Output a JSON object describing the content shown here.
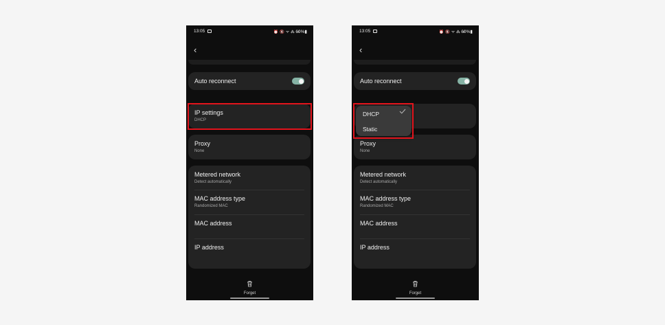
{
  "status": {
    "time": "13:05",
    "icons": "⏰ 🔇 ᯤ ⁂ .ıl",
    "battery": "60%▮"
  },
  "settings": {
    "auto_reconnect": "Auto reconnect",
    "ip_settings": "IP settings",
    "ip_value": "DHCP",
    "proxy": "Proxy",
    "proxy_value": "None",
    "metered": "Metered network",
    "metered_value": "Detect automatically",
    "mac_type": "MAC address type",
    "mac_type_value": "Randomized MAC",
    "mac_address": "MAC address",
    "ip_address": "IP address",
    "forget": "Forget"
  },
  "popup": {
    "selected": "DHCP",
    "other": "Static"
  },
  "colors": {
    "highlight": "#e3141c",
    "toggle": "#86b3a5"
  }
}
